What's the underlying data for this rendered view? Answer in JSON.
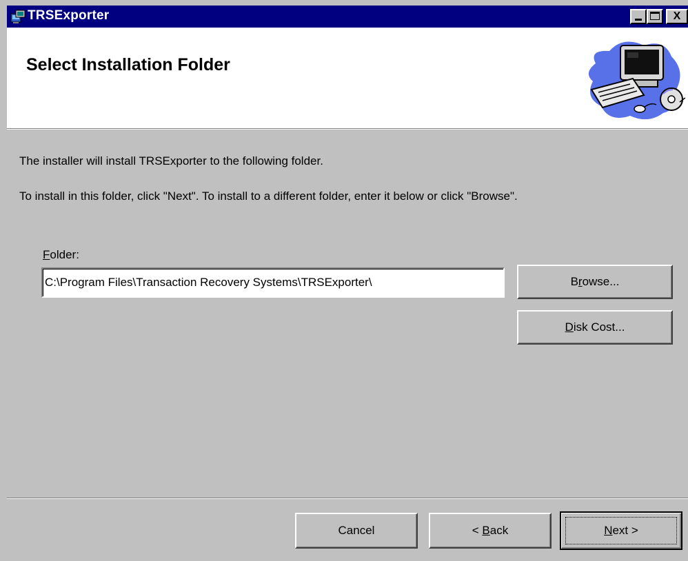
{
  "window": {
    "title": "TRSExporter",
    "controls": {
      "minimize": "_",
      "maximize": "□",
      "close": "X"
    }
  },
  "banner": {
    "title": "Select Installation Folder",
    "art_icon": "computer-cd-icon"
  },
  "body": {
    "line1": "The installer will install TRSExporter to the following folder.",
    "line2": "To install in this folder, click \"Next\". To install to a different folder, enter it below or click \"Browse\"."
  },
  "folder": {
    "label_accel": "F",
    "label_rest": "older:",
    "value": "C:\\Program Files\\Transaction Recovery Systems\\TRSExporter\\"
  },
  "buttons": {
    "browse_pre": "B",
    "browse_accel": "r",
    "browse_post": "owse...",
    "diskcost_accel": "D",
    "diskcost_post": "isk Cost...",
    "cancel": "Cancel",
    "back_pre": "< ",
    "back_accel": "B",
    "back_post": "ack",
    "next_accel": "N",
    "next_post": "ext >"
  },
  "colors": {
    "titlebar": "#000080",
    "face": "#c0c0c0",
    "banner": "#ffffff"
  }
}
